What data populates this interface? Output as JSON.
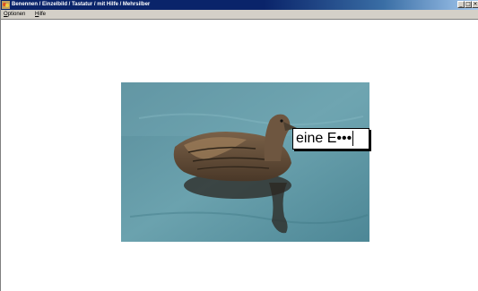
{
  "window": {
    "title": "Benennen / Einzelbild / Tastatur / mit Hilfe / Mehrsilber",
    "minimize_label": "_",
    "maximize_label": "□",
    "close_label": "×"
  },
  "menu": {
    "items": [
      {
        "first": "O",
        "rest": "ptionen"
      },
      {
        "first": "H",
        "rest": "ilfe"
      }
    ]
  },
  "main": {
    "picture": "duck-on-water",
    "answer_input_value": "eine E•••"
  },
  "colors": {
    "titlebar": "#0a246a",
    "water": "#5f95a2"
  }
}
